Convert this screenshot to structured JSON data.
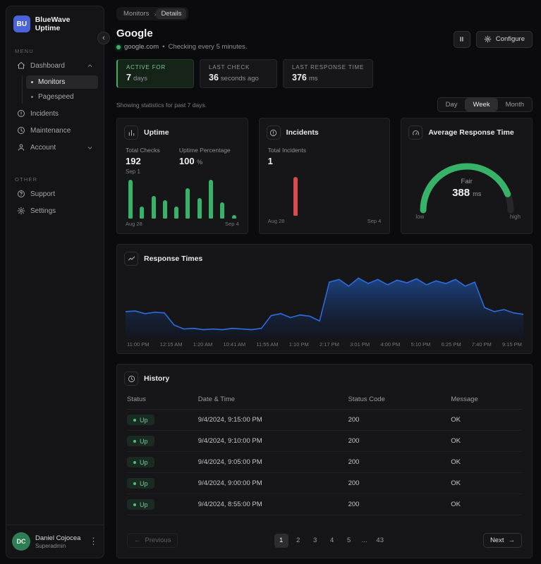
{
  "colors": {
    "brand_blue": "#4a63d8",
    "accent_green": "#36b368",
    "danger_red": "#d9494e",
    "chart_blue": "#2e6bdc"
  },
  "glyphs": {
    "breadcrumb_sep": "›",
    "collapse": "‹",
    "prev_arrow": "←",
    "next_arrow": "→",
    "kebab": "⋮"
  },
  "sidebar": {
    "logo_text": "BU",
    "app_name": "BlueWave Uptime",
    "menu_label": "MENU",
    "other_label": "OTHER",
    "items": {
      "dashboard": "Dashboard",
      "monitors": "Monitors",
      "pagespeed": "Pagespeed",
      "incidents": "Incidents",
      "maintenance": "Maintenance",
      "account": "Account",
      "support": "Support",
      "settings": "Settings"
    },
    "user": {
      "initials": "DC",
      "name": "Daniel Cojocea",
      "role": "Superadmin"
    }
  },
  "header": {
    "breadcrumb": [
      "Monitors",
      "Details"
    ],
    "title": "Google",
    "url": "google.com",
    "separator": "•",
    "check_note": "Checking every 5 minutes.",
    "configure_label": "Configure"
  },
  "stats": [
    {
      "label": "ACTIVE FOR",
      "value": "7",
      "unit": "days"
    },
    {
      "label": "LAST CHECK",
      "value": "36",
      "unit": "seconds ago"
    },
    {
      "label": "LAST RESPONSE TIME",
      "value": "376",
      "unit": "ms"
    }
  ],
  "filters": {
    "caption": "Showing statistics for past 7 days.",
    "options": [
      "Day",
      "Week",
      "Month"
    ],
    "selected": "Week"
  },
  "chart_data": [
    {
      "name": "uptime",
      "type": "bar",
      "title": "Uptime",
      "metrics": [
        {
          "label": "Total Checks",
          "value": "192",
          "sub": "Sep 1"
        },
        {
          "label": "Uptime Percentage",
          "value": "100",
          "unit": "%"
        }
      ],
      "values": [
        95,
        30,
        55,
        45,
        30,
        75,
        50,
        95,
        40,
        8
      ],
      "bar_color": "#36b368",
      "x_labels": [
        "Aug 28",
        "Sep 4"
      ]
    },
    {
      "name": "incidents",
      "type": "bar",
      "title": "Incidents",
      "metrics": [
        {
          "label": "Total Incidents",
          "value": "1"
        }
      ],
      "values": [
        0,
        0,
        95,
        0,
        0,
        0,
        0,
        0,
        0,
        0
      ],
      "bar_color": "#d9494e",
      "x_labels": [
        "Aug 28",
        "Sep 4"
      ]
    },
    {
      "name": "average-response-time",
      "type": "gauge",
      "title": "Average Response Time",
      "center_label": "Fair",
      "value": "388",
      "unit": "ms",
      "percent": 88,
      "color": "#36b368",
      "low_label": "low",
      "high_label": "high"
    },
    {
      "name": "response-times",
      "type": "area",
      "title": "Response Times",
      "x_labels": [
        "11:00 PM",
        "12:15 AM",
        "1:20 AM",
        "10:41 AM",
        "11:55 AM",
        "1:10 PM",
        "2:17 PM",
        "3:01 PM",
        "4:00 PM",
        "5:10 PM",
        "6:25 PM",
        "7:40 PM",
        "9:15 PM"
      ],
      "values": [
        40,
        41,
        37,
        39,
        38,
        20,
        14,
        15,
        13,
        14,
        13,
        15,
        14,
        13,
        15,
        34,
        37,
        31,
        35,
        33,
        26,
        84,
        88,
        78,
        90,
        82,
        88,
        80,
        87,
        83,
        89,
        80,
        86,
        82,
        88,
        78,
        84,
        46,
        40,
        43,
        38,
        36
      ],
      "line_color": "#2e6bdc"
    }
  ],
  "history": {
    "title": "History",
    "columns": [
      "Status",
      "Date & Time",
      "Status Code",
      "Message"
    ],
    "rows": [
      {
        "status": "Up",
        "datetime": "9/4/2024, 9:15:00 PM",
        "code": "200",
        "message": "OK"
      },
      {
        "status": "Up",
        "datetime": "9/4/2024, 9:10:00 PM",
        "code": "200",
        "message": "OK"
      },
      {
        "status": "Up",
        "datetime": "9/4/2024, 9:05:00 PM",
        "code": "200",
        "message": "OK"
      },
      {
        "status": "Up",
        "datetime": "9/4/2024, 9:00:00 PM",
        "code": "200",
        "message": "OK"
      },
      {
        "status": "Up",
        "datetime": "9/4/2024, 8:55:00 PM",
        "code": "200",
        "message": "OK"
      }
    ],
    "pagination": {
      "previous_label": "Previous",
      "next_label": "Next",
      "pages": [
        "1",
        "2",
        "3",
        "4",
        "5",
        "...",
        "43"
      ],
      "active_page": "1"
    }
  }
}
